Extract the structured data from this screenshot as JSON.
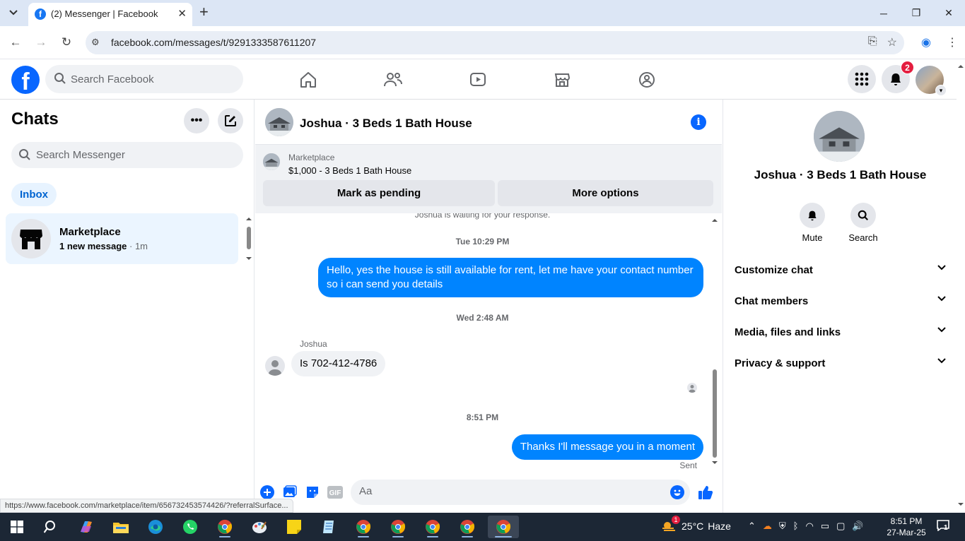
{
  "browser": {
    "tab_title": "(2) Messenger | Facebook",
    "tab_favicon": "f",
    "url": "facebook.com/messages/t/9291333587611207",
    "status_url": "https://www.facebook.com/marketplace/item/656732453574426/?referralSurface..."
  },
  "fb": {
    "logo": "f",
    "search_placeholder": "Search Facebook",
    "notification_count": "2",
    "accent": "#0866ff"
  },
  "chats": {
    "title": "Chats",
    "search_placeholder": "Search Messenger",
    "inbox_label": "Inbox",
    "items": [
      {
        "name": "Marketplace",
        "preview": "1 new message",
        "time": "· 1m"
      }
    ]
  },
  "conversation": {
    "title": "Joshua · 3 Beds 1 Bath House",
    "marketplace_label": "Marketplace",
    "listing": "$1,000 - 3 Beds 1 Bath House",
    "mark_pending": "Mark as pending",
    "more_options": "More options",
    "waiting_text": "Joshua is waiting for your response.",
    "messages": [
      {
        "type": "timestamp",
        "text": "Tue 10:29 PM"
      },
      {
        "type": "outgoing",
        "text": "Hello, yes the house is still available for rent, let me have your contact number so i can send you  details"
      },
      {
        "type": "timestamp",
        "text": "Wed 2:48 AM"
      },
      {
        "type": "sender",
        "text": "Joshua"
      },
      {
        "type": "incoming",
        "text": "Is 702-412-4786"
      },
      {
        "type": "timestamp",
        "text": "8:51 PM"
      },
      {
        "type": "outgoing",
        "text": "Thanks I'll message you in a moment"
      },
      {
        "type": "status",
        "text": "Sent"
      }
    ],
    "composer_placeholder": "Aa",
    "gif_label": "GIF"
  },
  "details": {
    "name": "Joshua · 3 Beds 1 Bath House",
    "mute_label": "Mute",
    "search_label": "Search",
    "sections": [
      "Customize chat",
      "Chat members",
      "Media, files and links",
      "Privacy & support"
    ]
  },
  "taskbar": {
    "weather_temp": "25°C",
    "weather_desc": "Haze",
    "weather_badge": "1",
    "time": "8:51 PM",
    "date": "27-Mar-25",
    "notifications": "1"
  }
}
